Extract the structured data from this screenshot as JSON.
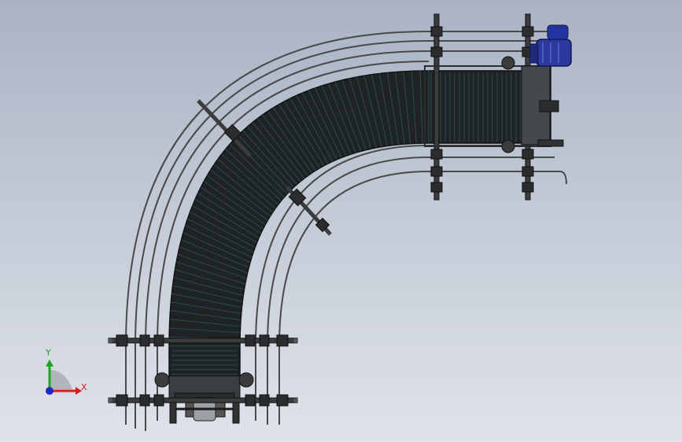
{
  "viewport": {
    "background_top": "#a9b3c4",
    "background_bottom": "#dfe3ea"
  },
  "model": {
    "description_icon": "curved-chain-conveyor-model",
    "belt_color": "#1f2323",
    "belt_link_color": "#2c4b4b",
    "rail_color": "#4a4a4a",
    "frame_color": "#303234",
    "motor_color": "#2c3aa0",
    "chain_link_count": 60
  },
  "triad": {
    "x_label": "X",
    "y_label": "Y",
    "x_color": "#d21e1e",
    "y_color": "#1ea51e",
    "z_color": "#1e28c8"
  }
}
